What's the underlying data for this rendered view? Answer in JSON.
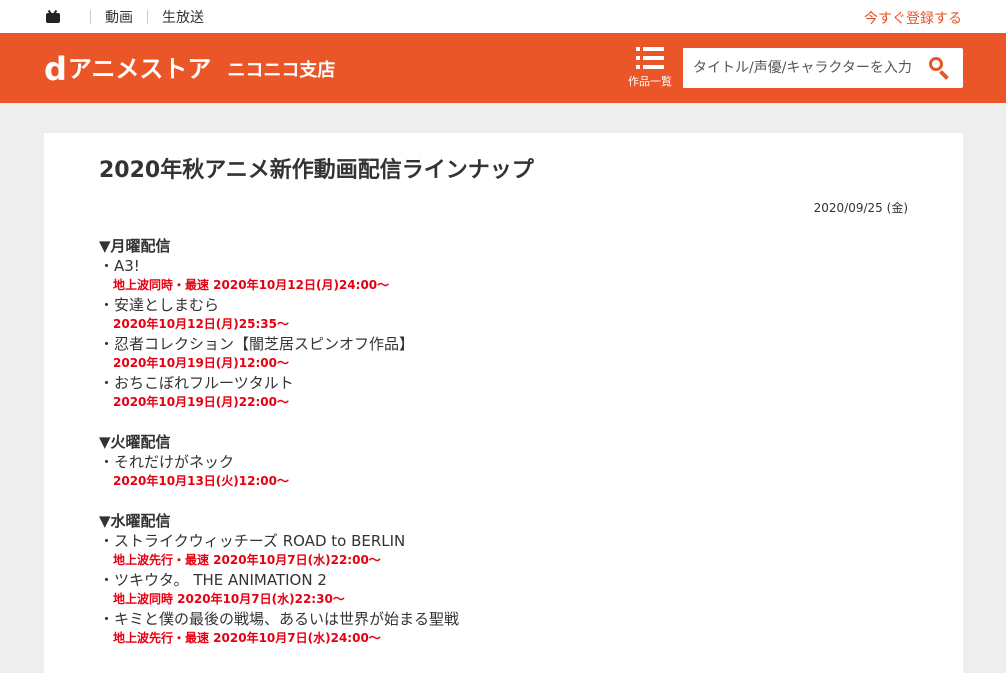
{
  "topbar": {
    "nav": [
      "動画",
      "生放送"
    ],
    "signup": "今すぐ登録する"
  },
  "header": {
    "logo_d": "d",
    "logo_main": "アニメストア",
    "logo_sub": "ニコニコ支店",
    "menu_label": "作品一覧",
    "search_placeholder": "タイトル/声優/キャラクターを入力"
  },
  "article": {
    "title": "2020年秋アニメ新作動画配信ラインナップ",
    "date": "2020/09/25 (金)",
    "days": [
      {
        "heading": "▼月曜配信",
        "items": [
          {
            "title": "・A3!",
            "schedule": "地上波同時・最速 2020年10月12日(月)24:00〜"
          },
          {
            "title": "・安達としまむら",
            "schedule": "2020年10月12日(月)25:35〜"
          },
          {
            "title": "・忍者コレクション【闇芝居スピンオフ作品】",
            "schedule": "2020年10月19日(月)12:00〜"
          },
          {
            "title": "・おちこぼれフルーツタルト",
            "schedule": "2020年10月19日(月)22:00〜"
          }
        ]
      },
      {
        "heading": "▼火曜配信",
        "items": [
          {
            "title": "・それだけがネック",
            "schedule": "2020年10月13日(火)12:00〜"
          }
        ]
      },
      {
        "heading": "▼水曜配信",
        "items": [
          {
            "title": "・ストライクウィッチーズ ROAD to BERLIN",
            "schedule": "地上波先行・最速 2020年10月7日(水)22:00〜"
          },
          {
            "title": "・ツキウタ。 THE ANIMATION 2",
            "schedule": "地上波同時 2020年10月7日(水)22:30〜"
          },
          {
            "title": "・キミと僕の最後の戦場、あるいは世界が始まる聖戦",
            "schedule": "地上波先行・最速 2020年10月7日(水)24:00〜"
          }
        ]
      }
    ]
  }
}
